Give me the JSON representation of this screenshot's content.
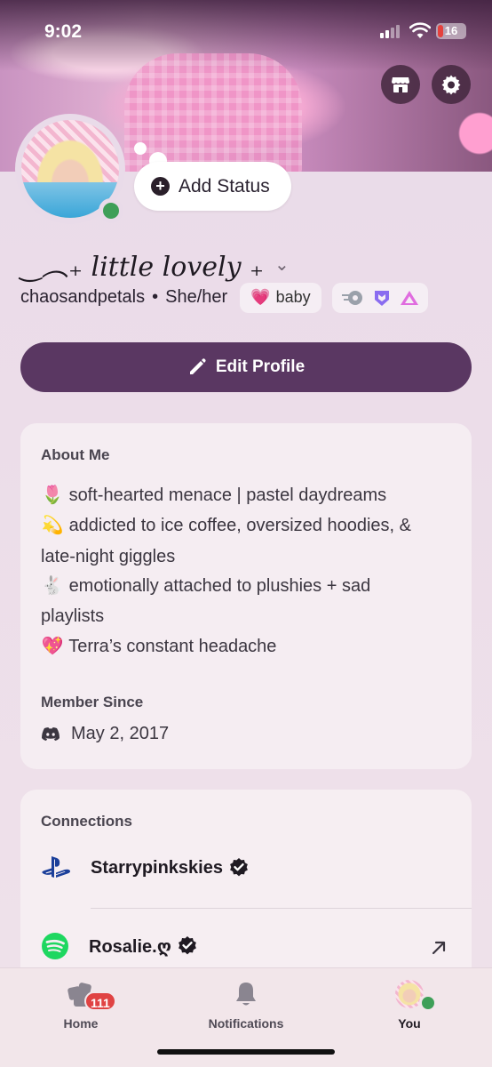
{
  "status_bar": {
    "time": "9:02",
    "battery": "16"
  },
  "header": {
    "shop_icon": "shop-icon",
    "settings_icon": "gear-icon"
  },
  "profile": {
    "add_status_label": "Add Status",
    "display_name": "‿︵₊ little lovely ₊",
    "username": "chaosandpetals",
    "pronouns": "She/her",
    "separator": "•",
    "tag_label": "baby",
    "tag_emoji": "💗",
    "edit_profile_label": "Edit Profile",
    "online": true
  },
  "about": {
    "title": "About Me",
    "lines": [
      {
        "emoji": "🌷",
        "text": "soft-hearted menace | pastel daydreams"
      },
      {
        "emoji": "💫",
        "text": "addicted to ice coffee, oversized hoodies, &"
      },
      {
        "emoji": "",
        "text": "late-night giggles"
      },
      {
        "emoji": "🐇",
        "text": "emotionally attached to plushies + sad"
      },
      {
        "emoji": "",
        "text": "playlists"
      },
      {
        "emoji": "💖",
        "text": "Terra’s constant headache"
      }
    ],
    "member_since_title": "Member Since",
    "member_since": "May 2, 2017"
  },
  "connections": {
    "title": "Connections",
    "items": [
      {
        "service": "PlayStation",
        "icon": "playstation-icon",
        "name": "Starrypinkskies",
        "verified": true
      },
      {
        "service": "Spotify",
        "icon": "spotify-icon",
        "name": "Rosalie.ღ",
        "verified": true
      }
    ]
  },
  "tabbar": {
    "home_label": "Home",
    "home_badge": "111",
    "notifications_label": "Notifications",
    "you_label": "You"
  },
  "colors": {
    "accent": "#5a3762",
    "online": "#3e9f58",
    "badge": "#e04343"
  }
}
